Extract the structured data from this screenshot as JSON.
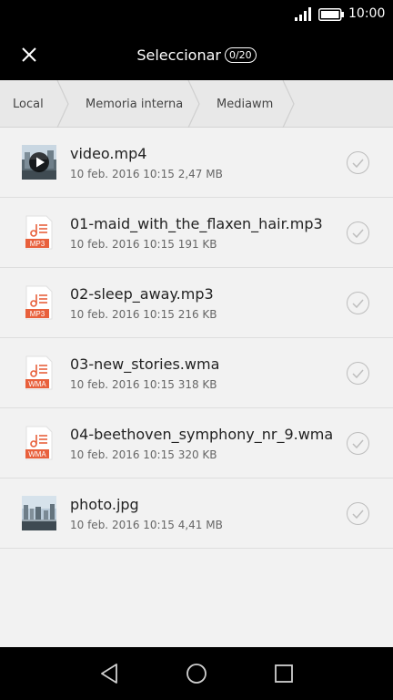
{
  "status_bar": {
    "time": "10:00"
  },
  "app_bar": {
    "title": "Seleccionar",
    "selection_count": "0/20"
  },
  "breadcrumb": [
    "Local",
    "Memoria interna",
    "Mediawm"
  ],
  "files": [
    {
      "name": "video.mp4",
      "date": "10 feb. 2016 10:15",
      "size": "2,47 MB",
      "kind": "video",
      "badge": ""
    },
    {
      "name": "01-maid_with_the_flaxen_hair.mp3",
      "date": "10 feb. 2016 10:15",
      "size": "191 KB",
      "kind": "audio",
      "badge": "MP3"
    },
    {
      "name": "02-sleep_away.mp3",
      "date": "10 feb. 2016 10:15",
      "size": "216 KB",
      "kind": "audio",
      "badge": "MP3"
    },
    {
      "name": "03-new_stories.wma",
      "date": "10 feb. 2016 10:15",
      "size": "318 KB",
      "kind": "audio",
      "badge": "WMA"
    },
    {
      "name": "04-beethoven_symphony_nr_9.wma",
      "date": "10 feb. 2016 10:15",
      "size": "320 KB",
      "kind": "audio",
      "badge": "WMA"
    },
    {
      "name": "photo.jpg",
      "date": "10 feb. 2016 10:15",
      "size": "4,41 MB",
      "kind": "image",
      "badge": ""
    }
  ],
  "icons": {
    "close": "close-icon",
    "check": "check-circle-icon",
    "back": "back-triangle-icon",
    "home": "home-circle-icon",
    "recents": "recents-square-icon"
  },
  "colors": {
    "accent_audio": "#e8603c",
    "bar": "#000000",
    "background": "#f2f2f2"
  }
}
